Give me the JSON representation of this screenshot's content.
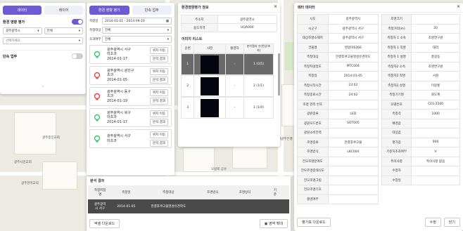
{
  "map": {
    "labels": [
      "광주광역시청",
      "광주중앙교회",
      "광주한미교회",
      "광주시민교회",
      "광주교회",
      "동천예술회관 갤러리",
      "오방로 공유",
      "남광주은행",
      "광주공원"
    ]
  },
  "left_panel": {
    "tabs": [
      "데이터",
      "레이어"
    ],
    "section_title": "환경 영향 평가",
    "city_select": "광주광역시",
    "district_select": "전체",
    "region_select": "선택하세요.",
    "danbok_label": "단속 업무",
    "toggle_off": "OFF"
  },
  "list_panel": {
    "tabs": [
      "환경 영향 평가",
      "단속 업무"
    ],
    "date_label": "측정일",
    "date_value": "2014-01-01 - 2014-09-10",
    "target_label": "측정대상",
    "target_value": "전체",
    "result_label": "초과여부",
    "result_value": "전체",
    "items": [
      {
        "line1": "광주광역시 서구",
        "line2": "미초과",
        "date": "2014-01-17",
        "status": "ok"
      },
      {
        "line1": "광주광역시 광산구",
        "line2": "초과",
        "date": "2014-01-05",
        "status": "bad"
      },
      {
        "line1": "광주광역시 동구",
        "line2": "초과",
        "date": "2014-01-19",
        "status": "bad"
      },
      {
        "line1": "광주광역시 북구",
        "line2": "미초과",
        "date": "2014-01-17",
        "status": "ok"
      },
      {
        "line1": "광주광역시 서구",
        "line2": "미초과",
        "date": "",
        "status": "ok"
      }
    ],
    "btn_locate": "위치 이동",
    "btn_result": "분석 결과"
  },
  "env_panel": {
    "title": "환경영향평가 정보",
    "info": [
      [
        "주소지",
        "광주광역시"
      ],
      [
        "용도지역",
        "UQA000"
      ]
    ],
    "image_list_title": "이미지 리스트",
    "headers": [
      "순번",
      "사진",
      "촬영자",
      "분석결과 수(현상/초과)"
    ],
    "rows": [
      {
        "no": "1",
        "author": "-",
        "result": "1 (0/5)"
      },
      {
        "no": "2",
        "author": "-",
        "result": "2 (1/1)"
      },
      {
        "no": "3",
        "author": "-",
        "result": "1 (1/0)"
      }
    ]
  },
  "result_panel": {
    "title": "분석 결과",
    "headers": [
      "측정지점\n명",
      "측정일",
      "측정대상",
      "조명방식",
      "조명방식",
      "기\n준"
    ],
    "row": [
      "광주광역\n시 서구",
      "2014-01-05",
      "한결후쿠고물영성유견학도",
      "",
      "",
      ""
    ],
    "excel_btn": "엑셀 다운로드",
    "photo_btn": "영역 확대"
  },
  "meta_panel": {
    "title": "메타 데이터",
    "left": [
      [
        "시도",
        "광주광역시"
      ],
      [
        "시군구",
        "광주광역시 서구"
      ],
      [
        "대상조명소재지",
        "광주광역시 서구"
      ],
      [
        "건물명",
        "영업이6266"
      ],
      [
        "측정대상",
        "한결후쿠고물영성유견학도"
      ],
      [
        "측정자설정도",
        "MTC004"
      ],
      [
        "측정일",
        "2014-01-05"
      ],
      [
        "측정시작시간",
        "23:02"
      ],
      [
        "측정종료시간",
        "24:02"
      ],
      [
        "조명 관리 번호",
        ""
      ],
      [
        "광원종류",
        "LED"
      ],
      [
        "광원모드번호",
        "SOT005"
      ],
      [
        "광원소비전력",
        ""
      ],
      [
        "조명종류",
        "한결후쿠고물"
      ],
      [
        "조명방식",
        "LKC004"
      ],
      [
        "전모조명분여도",
        ""
      ],
      [
        "전모조명종태식도",
        ""
      ],
      [
        "전모조명그립",
        ""
      ],
      [
        "전모조명기호",
        ""
      ],
      [
        "촬영여부",
        ""
      ]
    ],
    "right": [
      [
        "조명크기",
        ""
      ],
      [
        "측정거리(m)",
        "20"
      ],
      [
        "측정자 1 소속",
        "조명연구원"
      ],
      [
        "측정자 1 직명",
        "대리"
      ],
      [
        "측정자 1 성명",
        "홍길동"
      ],
      [
        "측정자2 소속",
        "조명연구원"
      ],
      [
        "측정자2 직명",
        "사원"
      ],
      [
        "측정자2 성명",
        "이몽룡"
      ],
      [
        "측정기기명",
        "휘도계"
      ],
      [
        "모델번호",
        "CES-2200"
      ],
      [
        "측정각",
        "1000"
      ],
      [
        "배경값",
        ""
      ],
      [
        "대상값",
        ""
      ],
      [
        "평가값",
        "900"
      ],
      [
        "기준치초과여부",
        "V"
      ],
      [
        "특이사항",
        "특이사항 없음"
      ],
      [
        "수정자",
        ""
      ],
      [
        "수정일",
        ""
      ]
    ],
    "download_btn": "평가표 다운로드",
    "edit_btn": "수정",
    "close_btn": "닫기"
  }
}
